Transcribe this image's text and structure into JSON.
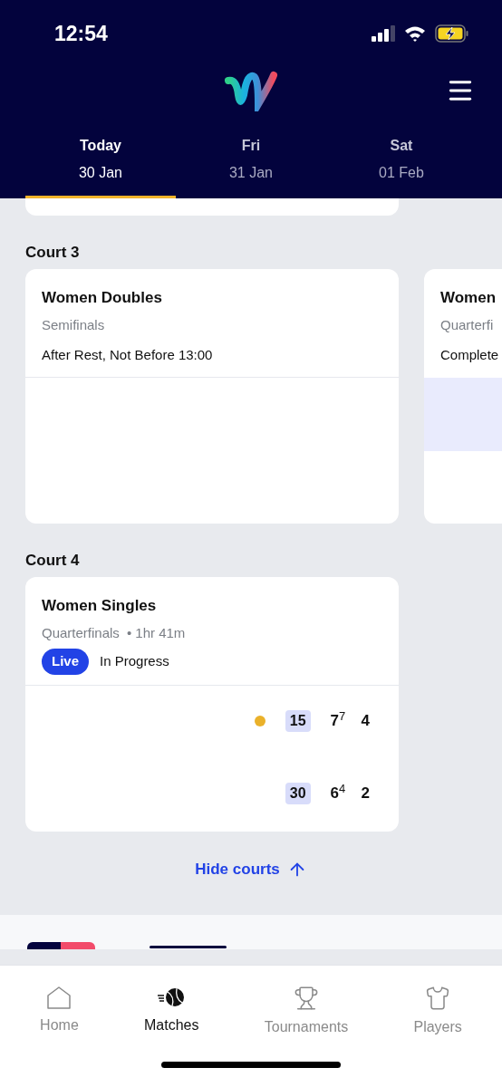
{
  "status_bar": {
    "time": "12:54"
  },
  "date_tabs": [
    {
      "day": "Today",
      "date": "30 Jan",
      "selected": true
    },
    {
      "day": "Fri",
      "date": "31 Jan",
      "selected": false
    },
    {
      "day": "Sat",
      "date": "01 Feb",
      "selected": false
    }
  ],
  "courts": [
    {
      "name": "Court 3",
      "cards": [
        {
          "kind": "full",
          "title": "Women Doubles",
          "round": "Semifinals",
          "status": "After Rest, Not Before 13:00"
        },
        {
          "kind": "partial",
          "title": "Women",
          "round": "Quarterfi",
          "status": "Complete"
        }
      ]
    },
    {
      "name": "Court 4",
      "cards": [
        {
          "kind": "full",
          "title": "Women Singles",
          "round": "Quarterfinals",
          "duration": "• 1hr 41m",
          "live": "Live",
          "status": "In Progress",
          "players": [
            {
              "serving": true,
              "points": "15",
              "sets": [
                {
                  "games": "7",
                  "tiebreak": "7"
                },
                {
                  "games": "4"
                }
              ]
            },
            {
              "serving": false,
              "points": "30",
              "sets": [
                {
                  "games": "6",
                  "tiebreak": "4"
                },
                {
                  "games": "2"
                }
              ]
            }
          ]
        }
      ]
    }
  ],
  "hide_courts": "Hide courts",
  "bottom_nav": [
    {
      "kind": "home",
      "label": "Home",
      "selected": false
    },
    {
      "kind": "matches",
      "label": "Matches",
      "selected": true
    },
    {
      "kind": "tournaments",
      "label": "Tournaments",
      "selected": false
    },
    {
      "kind": "players",
      "label": "Players",
      "selected": false
    }
  ]
}
